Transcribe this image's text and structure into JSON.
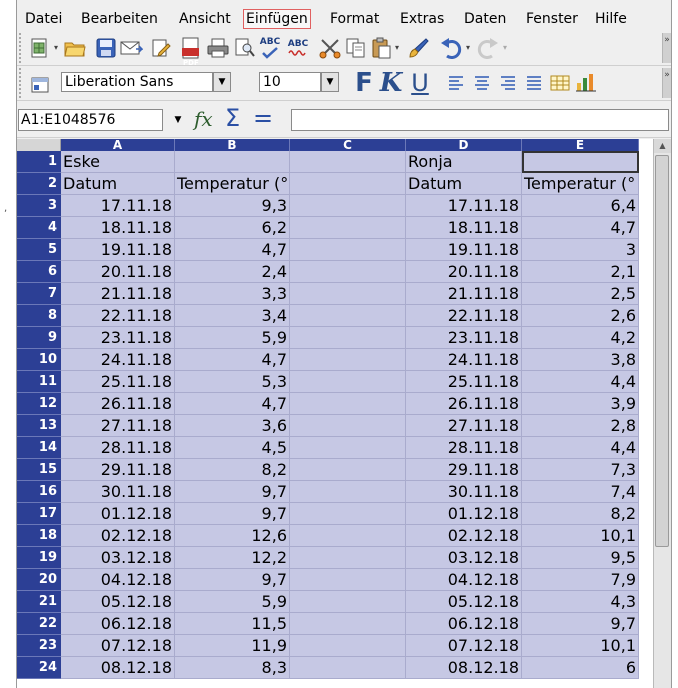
{
  "menu": [
    "Datei",
    "Bearbeiten",
    "Ansicht",
    "Einfügen",
    "Format",
    "Extras",
    "Daten",
    "Fenster",
    "Hilfe"
  ],
  "menu_active_index": 3,
  "toolbar": {
    "icons": [
      "new-document-icon",
      "open-folder-icon",
      "save-icon",
      "email-icon",
      "edit-file-icon",
      "export-pdf-icon",
      "print-icon",
      "print-preview-icon",
      "spellcheck-icon",
      "autospellcheck-icon",
      "cut-icon",
      "copy-icon",
      "paste-icon",
      "format-paintbrush-icon",
      "undo-icon",
      "redo-icon"
    ],
    "pdf_label": "PDF",
    "spell_label": "ABC",
    "spell_label2": "ABC"
  },
  "format_bar": {
    "font_name": "Liberation Sans",
    "font_size": "10",
    "bold_label": "F",
    "italic_label": "K",
    "underline_label": "U"
  },
  "formula_bar": {
    "name_box": "A1:E1048576",
    "fx_label": "fx",
    "sigma_label": "Σ",
    "equals_label": "=",
    "formula": ""
  },
  "columns": [
    "A",
    "B",
    "C",
    "D",
    "E"
  ],
  "rows": [
    {
      "n": "1",
      "a": "Eske",
      "b": "",
      "c": "",
      "d": "Ronja",
      "e": ""
    },
    {
      "n": "2",
      "a": "Datum",
      "b": "Temperatur (°C)",
      "c": "",
      "d": "Datum",
      "e": "Temperatur (°"
    },
    {
      "n": "3",
      "a": "17.11.18",
      "b": "9,3",
      "c": "",
      "d": "17.11.18",
      "e": "6,4"
    },
    {
      "n": "4",
      "a": "18.11.18",
      "b": "6,2",
      "c": "",
      "d": "18.11.18",
      "e": "4,7"
    },
    {
      "n": "5",
      "a": "19.11.18",
      "b": "4,7",
      "c": "",
      "d": "19.11.18",
      "e": "3"
    },
    {
      "n": "6",
      "a": "20.11.18",
      "b": "2,4",
      "c": "",
      "d": "20.11.18",
      "e": "2,1"
    },
    {
      "n": "7",
      "a": "21.11.18",
      "b": "3,3",
      "c": "",
      "d": "21.11.18",
      "e": "2,5"
    },
    {
      "n": "8",
      "a": "22.11.18",
      "b": "3,4",
      "c": "",
      "d": "22.11.18",
      "e": "2,6"
    },
    {
      "n": "9",
      "a": "23.11.18",
      "b": "5,9",
      "c": "",
      "d": "23.11.18",
      "e": "4,2"
    },
    {
      "n": "10",
      "a": "24.11.18",
      "b": "4,7",
      "c": "",
      "d": "24.11.18",
      "e": "3,8"
    },
    {
      "n": "11",
      "a": "25.11.18",
      "b": "5,3",
      "c": "",
      "d": "25.11.18",
      "e": "4,4"
    },
    {
      "n": "12",
      "a": "26.11.18",
      "b": "4,7",
      "c": "",
      "d": "26.11.18",
      "e": "3,9"
    },
    {
      "n": "13",
      "a": "27.11.18",
      "b": "3,6",
      "c": "",
      "d": "27.11.18",
      "e": "2,8"
    },
    {
      "n": "14",
      "a": "28.11.18",
      "b": "4,5",
      "c": "",
      "d": "28.11.18",
      "e": "4,4"
    },
    {
      "n": "15",
      "a": "29.11.18",
      "b": "8,2",
      "c": "",
      "d": "29.11.18",
      "e": "7,3"
    },
    {
      "n": "16",
      "a": "30.11.18",
      "b": "9,7",
      "c": "",
      "d": "30.11.18",
      "e": "7,4"
    },
    {
      "n": "17",
      "a": "01.12.18",
      "b": "9,7",
      "c": "",
      "d": "01.12.18",
      "e": "8,2"
    },
    {
      "n": "18",
      "a": "02.12.18",
      "b": "12,6",
      "c": "",
      "d": "02.12.18",
      "e": "10,1"
    },
    {
      "n": "19",
      "a": "03.12.18",
      "b": "12,2",
      "c": "",
      "d": "03.12.18",
      "e": "9,5"
    },
    {
      "n": "20",
      "a": "04.12.18",
      "b": "9,7",
      "c": "",
      "d": "04.12.18",
      "e": "7,9"
    },
    {
      "n": "21",
      "a": "05.12.18",
      "b": "5,9",
      "c": "",
      "d": "05.12.18",
      "e": "4,3"
    },
    {
      "n": "22",
      "a": "06.12.18",
      "b": "11,5",
      "c": "",
      "d": "06.12.18",
      "e": "9,7"
    },
    {
      "n": "23",
      "a": "07.12.18",
      "b": "11,9",
      "c": "",
      "d": "07.12.18",
      "e": "10,1"
    },
    {
      "n": "24",
      "a": "08.12.18",
      "b": "8,3",
      "c": "",
      "d": "08.12.18",
      "e": "6"
    }
  ],
  "colors": {
    "header_blue": "#2c3f95",
    "selection": "#c6c8e4"
  }
}
